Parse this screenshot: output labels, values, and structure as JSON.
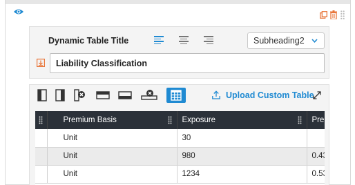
{
  "panel_title": {
    "label": "Dynamic Table Title",
    "heading_style_selected": "Subheading2",
    "title_value": "Liability Classification"
  },
  "toolbar": {
    "upload_label": "Upload Custom Table"
  },
  "table": {
    "columns": [
      "Premium Basis",
      "Exposure",
      "Prem"
    ],
    "rows": [
      [
        "Unit",
        "30",
        ""
      ],
      [
        "Unit",
        "980",
        "0.43"
      ],
      [
        "Unit",
        "1234",
        "0.53"
      ]
    ]
  },
  "colors": {
    "accent_blue": "#1f8ad2",
    "accent_orange": "#e8763a",
    "header_dark": "#2b3139"
  }
}
